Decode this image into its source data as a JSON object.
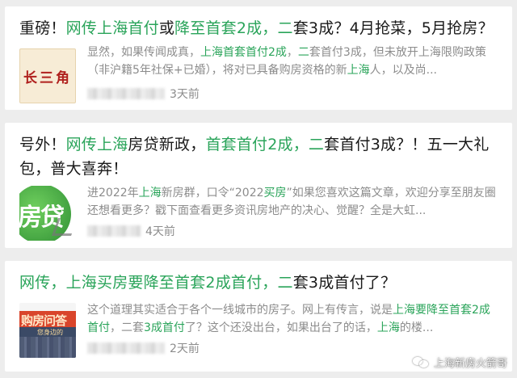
{
  "articles": [
    {
      "title": [
        "重磅！",
        "网传上海首付",
        "或",
        "降至首套2成，二",
        "套3成？4月抢菜，5月抢房？"
      ],
      "thumb_text": "长三角",
      "excerpt": [
        "显然，如果传闻成真，",
        "上海首套首付2成",
        "，",
        "二",
        "套首付3成，但未放开上海限购政策（非沪籍5年社保+已婚），将对已具备购房资格的新",
        "上海",
        "人，以及尚..."
      ],
      "time": "3天前"
    },
    {
      "title": [
        "号外！",
        "网传上海",
        "房贷新政，",
        "首套首付2成，二",
        "套首付3成？！五一大礼包，普大喜奔！"
      ],
      "thumb_text": "房贷",
      "excerpt": [
        "进2022年",
        "上海",
        "新房群，口令“2022",
        "买房",
        "”如果您喜欢这篇文章，欢迎分享至朋友圈还想看更多？戳下面查看更多资讯房地产的决心、觉醒？全是大虹..."
      ],
      "time": "4天前"
    },
    {
      "title": [
        "网传，上海买房要降至首套2成首付，二",
        "套3成首付了？"
      ],
      "thumb_text": "购房问答",
      "thumb_sub": "您身边的",
      "excerpt": [
        "这个道理其实适合于各个一线城市的房子。网上有传言，说是",
        "上海要降至首套2成首付",
        "，二套",
        "3成首付",
        "了？这个还没出台，如果出台了的话，",
        "上海",
        "的楼..."
      ],
      "time": "2天前"
    }
  ],
  "watermark": "上海新房火箭哥",
  "colors": {
    "highlight": "#2aa45a",
    "text": "#1a1a1a",
    "muted": "#8c8c8c"
  }
}
